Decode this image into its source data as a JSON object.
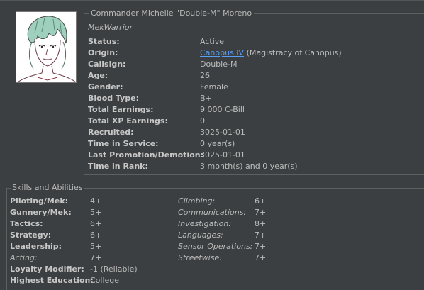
{
  "person": {
    "title": "Commander Michelle \"Double-M\" Moreno",
    "role": "MekWarrior"
  },
  "details": [
    {
      "label": "Status:",
      "value": "Active"
    },
    {
      "label": "Origin:",
      "link": "Canopus IV",
      "value": " (Magistracy of Canopus)"
    },
    {
      "label": "Callsign:",
      "value": "Double-M"
    },
    {
      "label": "Age:",
      "value": "26"
    },
    {
      "label": "Gender:",
      "value": "Female"
    },
    {
      "label": "Blood Type:",
      "value": "B+"
    },
    {
      "label": "Total Earnings:",
      "value": "9 000 C-Bill"
    },
    {
      "label": "Total XP Earnings:",
      "value": "0"
    },
    {
      "label": "Recruited:",
      "value": "3025-01-01"
    },
    {
      "label": "Time in Service:",
      "value": "0 year(s)"
    },
    {
      "label": "Last Promotion/Demotion:",
      "value": "3025-01-01"
    },
    {
      "label": "Time in Rank:",
      "value": "3 month(s) and 0 year(s)"
    }
  ],
  "skills": {
    "title": "Skills and Abilities",
    "left": [
      {
        "label": "Piloting/Mek:",
        "value": "4+",
        "style": "bold"
      },
      {
        "label": "Gunnery/Mek:",
        "value": "5+",
        "style": "bold"
      },
      {
        "label": "Tactics:",
        "value": "6+",
        "style": "bold"
      },
      {
        "label": "Strategy:",
        "value": "6+",
        "style": "bold"
      },
      {
        "label": "Leadership:",
        "value": "5+",
        "style": "bold"
      },
      {
        "label": "Acting:",
        "value": "7+",
        "style": "italic"
      },
      {
        "label": "Loyalty Modifier:",
        "value": "-1 (Reliable)",
        "style": "bold"
      },
      {
        "label": "Highest Education:",
        "value": "College",
        "style": "bold"
      }
    ],
    "right": [
      {
        "label": "Climbing:",
        "value": "6+"
      },
      {
        "label": "Communications:",
        "value": "7+"
      },
      {
        "label": "Investigation:",
        "value": "8+"
      },
      {
        "label": "Languages:",
        "value": "7+"
      },
      {
        "label": "Sensor Operations:",
        "value": "7+"
      },
      {
        "label": "Streetwise:",
        "value": "7+"
      }
    ]
  },
  "colors": {
    "background": "#3c3f41",
    "text": "#bbbbbb",
    "link": "#589df6",
    "border": "#5e6060"
  },
  "icons": {
    "portrait": "portrait-sketch"
  }
}
